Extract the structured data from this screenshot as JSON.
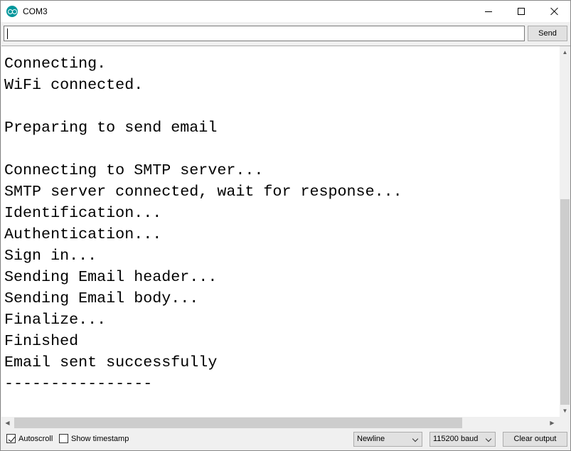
{
  "window": {
    "title": "COM3",
    "icon": "arduino-icon",
    "controls": [
      "minimize-icon",
      "maximize-icon",
      "close-icon"
    ]
  },
  "input": {
    "value": "",
    "send_label": "Send"
  },
  "output": {
    "lines": [
      "Connecting.",
      "WiFi connected.",
      "",
      "Preparing to send email",
      "",
      "Connecting to SMTP server...",
      "SMTP server connected, wait for response...",
      "Identification...",
      "Authentication...",
      "Sign in...",
      "Sending Email header...",
      "Sending Email body...",
      "Finalize...",
      "Finished",
      "Email sent successfully",
      "----------------"
    ]
  },
  "bottom": {
    "autoscroll_label": "Autoscroll",
    "autoscroll_checked": true,
    "timestamp_label": "Show timestamp",
    "timestamp_checked": false,
    "line_ending": "Newline",
    "baud_rate": "115200 baud",
    "clear_label": "Clear output"
  }
}
